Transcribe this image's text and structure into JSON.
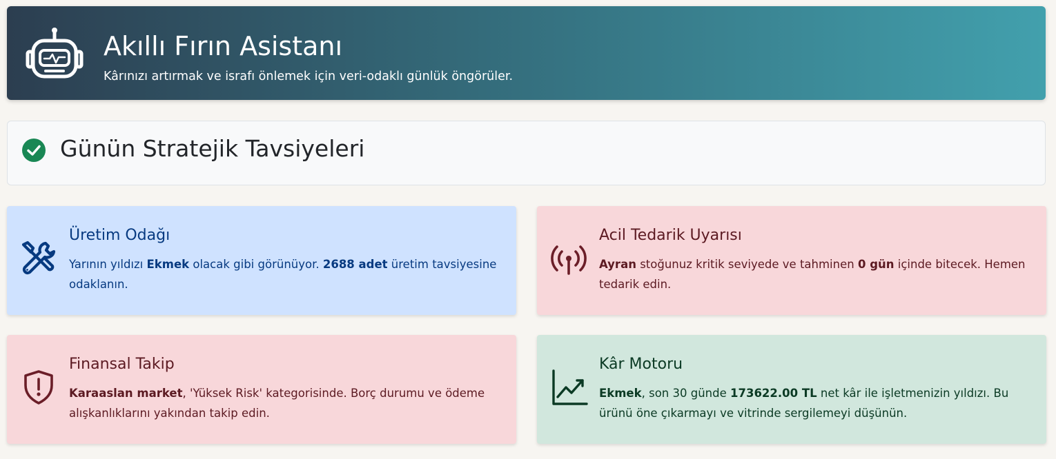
{
  "header": {
    "title": "Akıllı Fırın Asistanı",
    "subtitle": "Kârınızı artırmak ve israfı önlemek için veri-odaklı günlük öngörüler.",
    "icon": "robot-icon"
  },
  "section": {
    "title": "Günün Stratejik Tavsiyeleri",
    "icon": "check-circle-icon",
    "icon_color": "#198754"
  },
  "cards": [
    {
      "title": "Üretim Odağı",
      "icon": "tools-icon",
      "text_1": "Yarının yıldızı ",
      "bold_1": "Ekmek",
      "text_2": " olacak gibi görünüyor. ",
      "bold_2": "2688 adet",
      "text_3": " üretim tavsiyesine odaklanın.",
      "color": "#cfe2ff"
    },
    {
      "title": "Acil Tedarik Uyarısı",
      "icon": "broadcast-icon",
      "bold_1": "Ayran",
      "text_1": " stoğunuz kritik seviyede ve tahminen ",
      "bold_2": "0 gün",
      "text_2": " içinde bitecek. Hemen tedarik edin.",
      "color": "#f8d7da"
    },
    {
      "title": "Finansal Takip",
      "icon": "shield-exclamation-icon",
      "bold_1": "Karaaslan market",
      "text_1": ", 'Yüksek Risk' kategorisinde. Borç durumu ve ödeme alışkanlıklarını yakından takip edin.",
      "color": "#f8d7da"
    },
    {
      "title": "Kâr Motoru",
      "icon": "graph-up-icon",
      "bold_1": "Ekmek",
      "text_1": ", son 30 günde ",
      "bold_2": "173622.00 TL",
      "text_2": " net kâr ile işletmenizin yıldızı. Bu ürünü öne çıkarmayı ve vitrinde sergilemeyi düşünün.",
      "color": "#d1e7dd"
    }
  ]
}
